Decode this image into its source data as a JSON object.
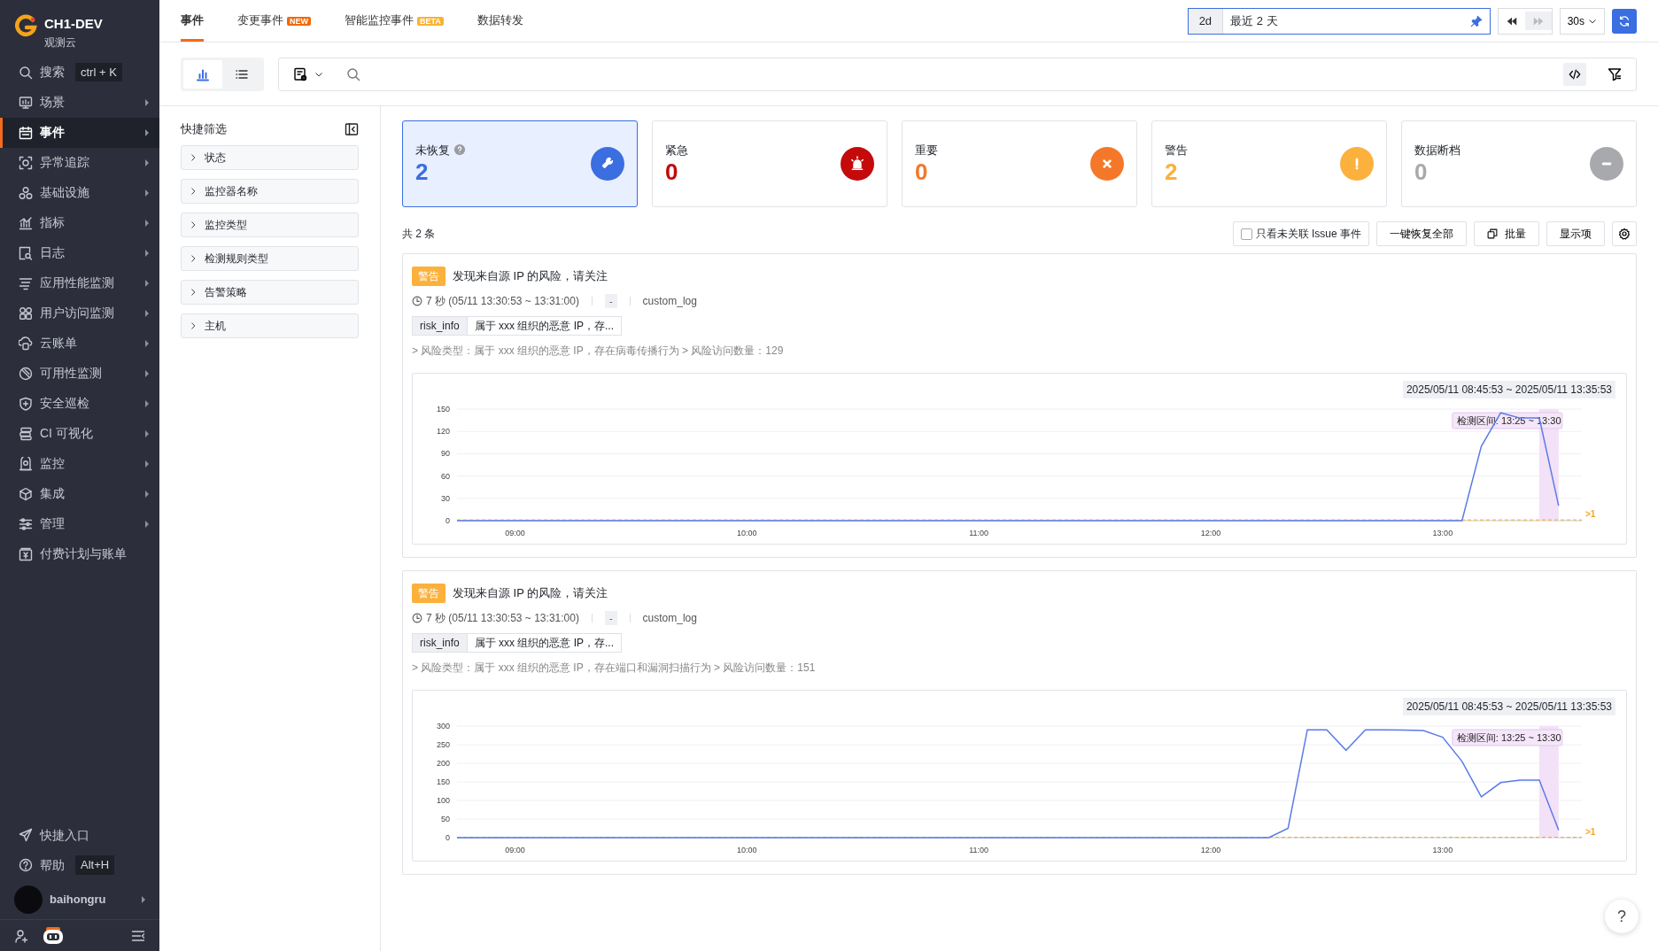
{
  "app": {
    "name": "CH1-DEV",
    "workspace": "观测云"
  },
  "sidebar": {
    "items": [
      {
        "label": "搜索",
        "shortcut": "ctrl + K",
        "selected": false,
        "submenu": false
      },
      {
        "label": "场景",
        "selected": false,
        "submenu": true
      },
      {
        "label": "事件",
        "selected": true,
        "submenu": true
      },
      {
        "label": "异常追踪",
        "selected": false,
        "submenu": true
      },
      {
        "label": "基础设施",
        "selected": false,
        "submenu": true
      },
      {
        "label": "指标",
        "selected": false,
        "submenu": true
      },
      {
        "label": "日志",
        "selected": false,
        "submenu": true
      },
      {
        "label": "应用性能监测",
        "selected": false,
        "submenu": true
      },
      {
        "label": "用户访问监测",
        "selected": false,
        "submenu": true
      },
      {
        "label": "云账单",
        "selected": false,
        "submenu": true
      },
      {
        "label": "可用性监测",
        "selected": false,
        "submenu": true
      },
      {
        "label": "安全巡检",
        "selected": false,
        "submenu": true
      },
      {
        "label": "CI 可视化",
        "selected": false,
        "submenu": true
      },
      {
        "label": "监控",
        "selected": false,
        "submenu": true
      },
      {
        "label": "集成",
        "selected": false,
        "submenu": true
      },
      {
        "label": "管理",
        "selected": false,
        "submenu": true
      },
      {
        "label": "付费计划与账单",
        "selected": false,
        "submenu": false
      }
    ],
    "footer": [
      {
        "label": "快捷入口"
      },
      {
        "label": "帮助",
        "shortcut": "Alt+H"
      }
    ],
    "user": "baihongru"
  },
  "tabs": [
    {
      "label": "事件",
      "selected": true
    },
    {
      "label": "变更事件",
      "badge": {
        "text": "NEW",
        "color": "#f0690a"
      },
      "selected": false
    },
    {
      "label": "智能监控事件",
      "badge": {
        "text": "BETA",
        "color": "#f9b233"
      },
      "selected": false
    },
    {
      "label": "数据转发",
      "selected": false
    }
  ],
  "time_range": {
    "short": "2d",
    "label": "最近 2 天",
    "refresh": "30s"
  },
  "view_toggle": [
    {
      "kind": "chart",
      "selected": true
    },
    {
      "kind": "list",
      "selected": false
    }
  ],
  "quick_filter": {
    "title": "快捷筛选",
    "groups": [
      "状态",
      "监控器名称",
      "监控类型",
      "检测规则类型",
      "告警策略",
      "主机"
    ]
  },
  "stats": [
    {
      "kind": "unrecovered",
      "label": "未恢复",
      "value": "2",
      "color": "#3b6ee0",
      "help": true,
      "selected": true
    },
    {
      "kind": "critical",
      "label": "紧急",
      "value": "0",
      "color": "#c40a0a",
      "help": false,
      "selected": false
    },
    {
      "kind": "error",
      "label": "重要",
      "value": "0",
      "color": "#f5782a",
      "help": false,
      "selected": false
    },
    {
      "kind": "warning",
      "label": "警告",
      "value": "2",
      "color": "#fbb13c",
      "help": false,
      "selected": false
    },
    {
      "kind": "nodata",
      "label": "数据断档",
      "value": "0",
      "color": "#a8a9ad",
      "help": false,
      "selected": false
    }
  ],
  "total": "共 2 条",
  "actions": {
    "only_unlinked": {
      "label": "只看未关联 Issue 事件",
      "checked": false
    },
    "buttons": [
      {
        "kind": "plain",
        "label": "一键恢复全部"
      },
      {
        "kind": "batch",
        "label": "批量"
      },
      {
        "kind": "plain",
        "label": "显示项"
      },
      {
        "kind": "settings"
      }
    ]
  },
  "events": [
    {
      "level": {
        "text": "警告",
        "color": "#fbb13c"
      },
      "title": "发现来自源 IP 的风险，请关注",
      "duration": "7 秒 (05/11 13:30:53 ~ 13:31:00)",
      "dash": "-",
      "source": "custom_log",
      "tag_key": "risk_info",
      "tag_value": "属于 xxx 组织的恶意 IP，存...",
      "detail": "> 风险类型：属于 xxx 组织的恶意 IP，存在病毒传播行为 > 风险访问数量：129",
      "range": "2025/05/11 08:45:53 ~ 2025/05/11 13:35:53",
      "chart_data": {
        "type": "line",
        "x": [
          525,
          785,
          790,
          795,
          800,
          805,
          810
        ],
        "series": [
          {
            "color": "#5b7be8",
            "values": [
              0,
              0,
              100,
              145,
              138,
              138,
              20
            ]
          }
        ],
        "xlim": [
          525,
          816
        ],
        "ylim": [
          0,
          150
        ],
        "grid": true,
        "xticks": [
          {
            "value": 540,
            "label": "09:00"
          },
          {
            "value": 600,
            "label": "10:00"
          },
          {
            "value": 660,
            "label": "11:00"
          },
          {
            "value": 720,
            "label": "12:00"
          },
          {
            "value": 780,
            "label": "13:00"
          }
        ],
        "yticks": [
          0,
          30,
          60,
          90,
          120,
          150
        ],
        "bands": [
          {
            "axis": "x",
            "from": 805,
            "to": 810,
            "label": "检测区间: 13:25 ~ 13:30",
            "color": "#f2e1f7"
          }
        ],
        "ref_lines": [
          {
            "axis": "y",
            "value": 1,
            "label": ">1",
            "color": "#f5a623"
          }
        ]
      }
    },
    {
      "level": {
        "text": "警告",
        "color": "#fbb13c"
      },
      "title": "发现来自源 IP 的风险，请关注",
      "duration": "7 秒 (05/11 13:30:53 ~ 13:31:00)",
      "dash": "-",
      "source": "custom_log",
      "tag_key": "risk_info",
      "tag_value": "属于 xxx 组织的恶意 IP，存...",
      "detail": "> 风险类型：属于 xxx 组织的恶意 IP，存在端口和漏洞扫描行为 > 风险访问数量：151",
      "range": "2025/05/11 08:45:53 ~ 2025/05/11 13:35:53",
      "chart_data": {
        "type": "line",
        "x": [
          525,
          735,
          740,
          745,
          750,
          755,
          760,
          765,
          770,
          775,
          780,
          785,
          790,
          795,
          800,
          805,
          810
        ],
        "series": [
          {
            "color": "#5b7be8",
            "values": [
              0,
              0,
              25,
              290,
              290,
              235,
              290,
              290,
              289,
              288,
              270,
              205,
              110,
              148,
              155,
              155,
              20
            ]
          }
        ],
        "xlim": [
          525,
          816
        ],
        "ylim": [
          0,
          300
        ],
        "grid": true,
        "xticks": [
          {
            "value": 540,
            "label": "09:00"
          },
          {
            "value": 600,
            "label": "10:00"
          },
          {
            "value": 660,
            "label": "11:00"
          },
          {
            "value": 720,
            "label": "12:00"
          },
          {
            "value": 780,
            "label": "13:00"
          }
        ],
        "yticks": [
          0,
          50,
          100,
          150,
          200,
          250,
          300
        ],
        "bands": [
          {
            "axis": "x",
            "from": 805,
            "to": 810,
            "label": "检测区间: 13:25 ~ 13:30",
            "color": "#f2e1f7"
          }
        ],
        "ref_lines": [
          {
            "axis": "y",
            "value": 1,
            "label": ">1",
            "color": "#f5a623"
          }
        ]
      }
    }
  ],
  "help_button": "?"
}
